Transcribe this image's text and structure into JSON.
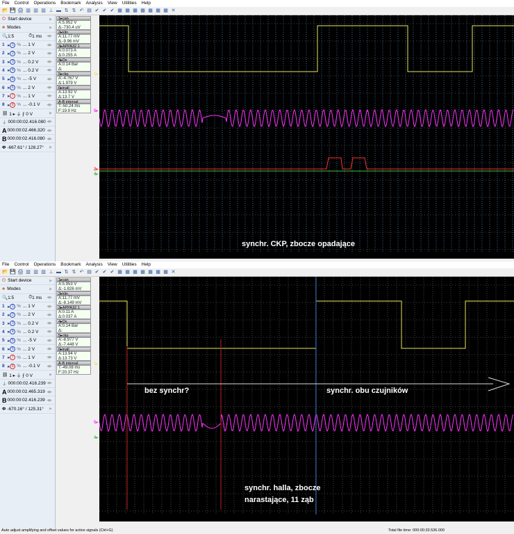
{
  "menu": [
    "File",
    "Control",
    "Operations",
    "Bookmark",
    "Analysis",
    "View",
    "Utilities",
    "Help"
  ],
  "panes": [
    {
      "start_device": "Start device",
      "modes": "Modes",
      "zoom": "1:5",
      "timebase": "1 ms",
      "channels": [
        {
          "n": "1",
          "v": "... 1 V"
        },
        {
          "n": "2",
          "v": "... 2 V"
        },
        {
          "n": "3",
          "v": "... 0.2 V"
        },
        {
          "n": "4",
          "v": "... 0.2 V"
        },
        {
          "n": "5",
          "v": "... -5 V"
        },
        {
          "n": "6",
          "v": "... 2 V"
        },
        {
          "n": "7",
          "v": "... 1 V"
        },
        {
          "n": "8",
          "v": "... -0.1 V"
        }
      ],
      "trigger": "1 ▸ ⏚ ⨍ 0 V",
      "cursor_t": "000:00:02.416.080",
      "a": "000:00:02.466.320",
      "b": "000:00:02.416.080",
      "phi": "-667.61° / 128.27°",
      "mini": [
        {
          "h": "1▸can",
          "a": "A:5.952 V",
          "d": "Δ:-730.4 uV"
        },
        {
          "h": "2▸klin",
          "a": "A:11.77 mV",
          "d": "Δ:-9.96 mV"
        },
        {
          "h": "3▸APPA32 1",
          "a": "A:0.073 A",
          "d": "Δ:0.255 A"
        },
        {
          "h": "4▸Dx",
          "a": "A:0.14 Bar",
          "d": "Δ:"
        },
        {
          "h": "5▸ckp",
          "a": "A:-4.767 V",
          "d": "Δ:1.979 V"
        },
        {
          "h": "6▸inall",
          "a": "A:13.92 V",
          "d": "Δ:13.7 V"
        },
        {
          "h": "A-B interval",
          "a": "T:-50.24 ms",
          "d": "F:19.9 Hz"
        }
      ],
      "annotations": [
        "synchr. CKP, zbocze opadające"
      ]
    },
    {
      "start_device": "Start device",
      "modes": "Modes",
      "zoom": "1:5",
      "timebase": "1 ms",
      "channels": [
        {
          "n": "1",
          "v": "... 1 V"
        },
        {
          "n": "2",
          "v": "... 2 V"
        },
        {
          "n": "3",
          "v": "... 0.2 V"
        },
        {
          "n": "4",
          "v": "... 0.2 V"
        },
        {
          "n": "5",
          "v": "... -5 V"
        },
        {
          "n": "6",
          "v": "... 2 V"
        },
        {
          "n": "7",
          "v": "... 1 V"
        },
        {
          "n": "8",
          "v": "... -0.1 V"
        }
      ],
      "trigger": "1 ▸ ⏚ ⨍ 0 V",
      "cursor_t": "000:00:02.416.239",
      "a": "000:00:02.465.319",
      "b": "000:00:02.416.239",
      "phi": "-670.16° / 125.31°",
      "mini": [
        {
          "h": "1▸can",
          "a": "A:5.953 V",
          "d": "Δ:-1.826 mV"
        },
        {
          "h": "2▸klin",
          "a": "A:11.77 mV",
          "d": "Δ:-8.149 mV"
        },
        {
          "h": "3▸APPA32 1",
          "a": "A:0.11 A",
          "d": "Δ:0.037 A"
        },
        {
          "h": "4▸Dx",
          "a": "A:0.14 Bar",
          "d": "Δ:"
        },
        {
          "h": "5▸ckp",
          "a": "A:-8.977 V",
          "d": "Δ:-7.448 V"
        },
        {
          "h": "6▸inall",
          "a": "A:13.94 V",
          "d": "Δ:13.73 V"
        },
        {
          "h": "A-B interval",
          "a": "T:-49.08 ms",
          "d": "F:20.37 Hz"
        }
      ],
      "annotations": [
        "bez synchr?",
        "synchr. obu czujników",
        "synchr. halla, zbocze",
        "narastające, 11 ząb"
      ]
    }
  ],
  "status": {
    "hint": "Auto adjust amplifying and offset values for active signals (Ctrl+G)",
    "total": "Total file time: 000:00:33.536.000"
  },
  "colors": {
    "ch1": "#e8e860",
    "ch5": "#ff30ff",
    "ch2": "#ff3030",
    "grid": "#3a6a9a"
  }
}
